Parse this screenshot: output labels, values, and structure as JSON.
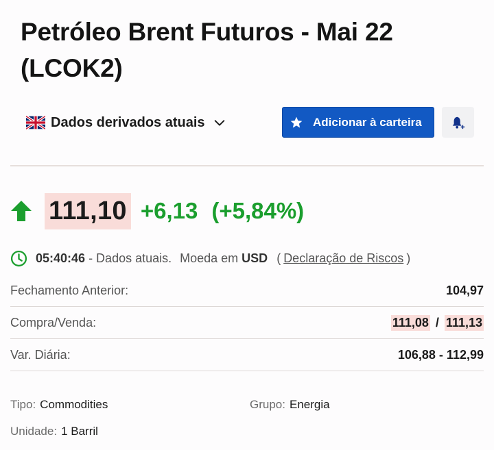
{
  "header": {
    "title": "Petróleo Brent Futuros - Mai 22 (LCOK2)"
  },
  "toolbar": {
    "source_label": "Dados derivados atuais",
    "add_portfolio_label": "Adicionar à carteira"
  },
  "quote": {
    "price": "111,10",
    "change": "+6,13",
    "change_pct": "(+5,84%)",
    "direction": "up",
    "up_color": "#1b9e2e"
  },
  "meta": {
    "time": "05:40:46",
    "status": "- Dados atuais.",
    "currency_prefix": "Moeda em",
    "currency": "USD",
    "open_paren": "(",
    "risk_link": "Declaração de Riscos",
    "close_paren": ")"
  },
  "stats": {
    "prev_close_label": "Fechamento Anterior:",
    "prev_close_value": "104,97",
    "bid_ask_label": "Compra/Venda:",
    "bid": "111,08",
    "slash": "/",
    "ask": "111,13",
    "day_range_label": "Var. Diária:",
    "day_range_value": "106,88 - 112,99"
  },
  "info": {
    "type_label": "Tipo:",
    "type_value": "Commodities",
    "group_label": "Grupo:",
    "group_value": "Energia",
    "unit_label": "Unidade:",
    "unit_value": "1 Barril"
  },
  "colors": {
    "accent_blue": "#1259c3",
    "highlight": "#f9dcd9"
  },
  "icons": [
    "uk-flag-icon",
    "chevron-down-icon",
    "star-icon",
    "bell-plus-icon",
    "up-arrow-icon",
    "clock-icon"
  ]
}
